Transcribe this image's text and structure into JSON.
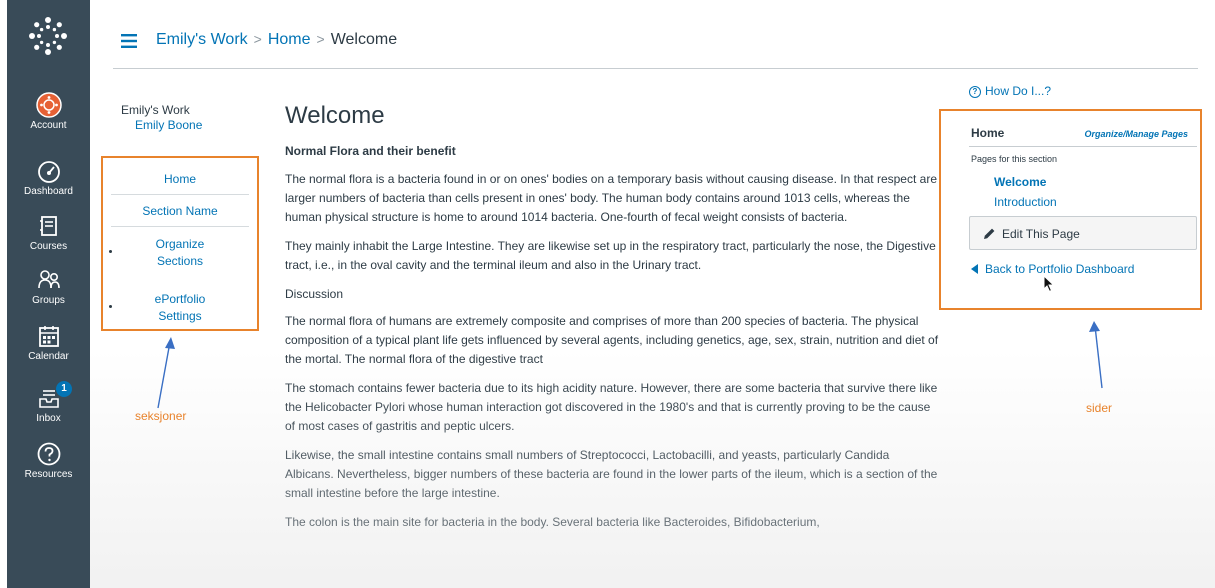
{
  "global_nav": {
    "items": [
      {
        "label": "Account",
        "icon": "account-avatar-icon"
      },
      {
        "label": "Dashboard",
        "icon": "dashboard-icon"
      },
      {
        "label": "Courses",
        "icon": "courses-icon"
      },
      {
        "label": "Groups",
        "icon": "groups-icon"
      },
      {
        "label": "Calendar",
        "icon": "calendar-icon"
      },
      {
        "label": "Inbox",
        "icon": "inbox-icon",
        "badge": "1"
      },
      {
        "label": "Resources",
        "icon": "help-icon"
      }
    ]
  },
  "breadcrumb": {
    "items": [
      "Emily's Work",
      "Home",
      "Welcome"
    ],
    "separator": ">"
  },
  "portfolio": {
    "title": "Emily's Work",
    "owner": "Emily Boone"
  },
  "sections_nav": {
    "items": [
      "Home",
      "Section Name",
      "Organize\nSections",
      "ePortfolio\nSettings"
    ]
  },
  "page": {
    "title": "Welcome",
    "subtitle": "Normal Flora and their benefit",
    "paragraphs": [
      "The normal flora is a bacteria found in or on ones' bodies on a temporary basis without causing disease. In that respect are larger numbers of bacteria than cells present in ones' body. The human body contains around 1013 cells, whereas the human physical structure is home to around 1014 bacteria. One-fourth of fecal weight consists of bacteria.",
      "They mainly inhabit the Large Intestine. They are likewise set up in the respiratory tract, particularly the nose, the Digestive tract, i.e., in the oval cavity and the terminal ileum and also in the Urinary tract.",
      "Discussion",
      "The normal flora of humans are extremely composite and comprises of more than 200 species of bacteria. The physical composition of a typical plant life gets influenced by several agents, including genetics, age, sex, strain, nutrition and diet of the mortal. The normal flora of the digestive tract",
      "The stomach contains fewer bacteria due to its high acidity nature. However, there are some bacteria that survive there like the Helicobacter Pylori whose human interaction got discovered in the 1980's and that is currently proving to be the cause of most cases of gastritis and peptic ulcers.",
      "Likewise, the small intestine contains small numbers of Streptococci, Lactobacilli, and yeasts, particularly Candida Albicans. Nevertheless, bigger numbers of these bacteria are found in the lower parts of the ileum, which is a section of the small intestine before the large intestine.",
      "The colon is the main site for bacteria in the body. Several bacteria like Bacteroides, Bifidobacterium,"
    ]
  },
  "sidebar": {
    "how_do_i": "How Do I...?",
    "section_title": "Home",
    "manage_link": "Organize/Manage Pages",
    "pages_label": "Pages for this section",
    "pages": [
      "Welcome",
      "Introduction"
    ],
    "edit_button": "Edit This Page",
    "back_link": "Back to Portfolio Dashboard"
  },
  "annotations": {
    "left": "seksjoner",
    "right": "sider",
    "color": "#e8832c"
  },
  "colors": {
    "nav_bg": "#394b58",
    "link": "#0374b5",
    "text": "#2d3b45"
  }
}
